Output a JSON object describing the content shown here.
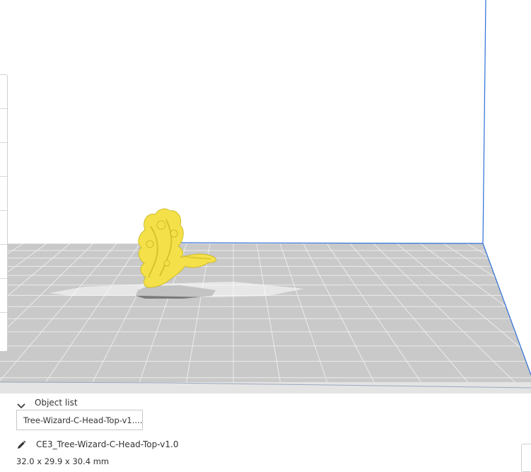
{
  "object_list": {
    "header_label": "Object list",
    "selected_object": "Tree-Wizard-C-Head-Top-v1....",
    "file_name": "CE3_Tree-Wizard-C-Head-Top-v1.0",
    "dimensions": "32.0 x 29.9 x 30.4 mm"
  },
  "viewport": {
    "model_color": "#f4e14a",
    "build_plate_color": "#c8c8c8",
    "volume_edge_color": "#2e6fd8"
  },
  "icons": {
    "collapse": "chevron-down-icon",
    "edit": "pencil-icon"
  }
}
